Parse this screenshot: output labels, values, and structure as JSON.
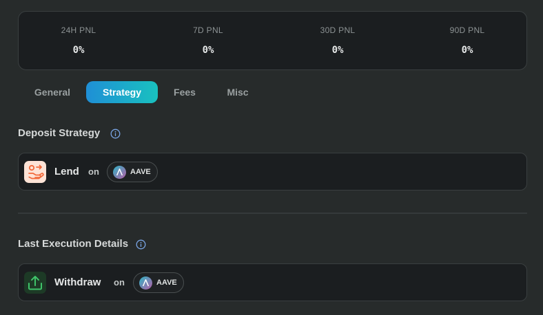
{
  "pnl": [
    {
      "label": "24H PNL",
      "value": "0%"
    },
    {
      "label": "7D PNL",
      "value": "0%"
    },
    {
      "label": "30D PNL",
      "value": "0%"
    },
    {
      "label": "90D PNL",
      "value": "0%"
    }
  ],
  "tabs": [
    {
      "label": "General",
      "active": false
    },
    {
      "label": "Strategy",
      "active": true
    },
    {
      "label": "Fees",
      "active": false
    },
    {
      "label": "Misc",
      "active": false
    }
  ],
  "deposit_strategy": {
    "title": "Deposit Strategy",
    "info_icon": "info-icon",
    "action_icon": "lend-icon",
    "action": "Lend",
    "connector": "on",
    "protocol_logo": "aave-logo",
    "protocol": "AAVE"
  },
  "last_execution": {
    "title": "Last Execution Details",
    "info_icon": "info-icon",
    "action_icon": "withdraw-icon",
    "action": "Withdraw",
    "connector": "on",
    "protocol_logo": "aave-logo",
    "protocol": "AAVE"
  },
  "colors": {
    "background": "#272b2b",
    "card": "#1b1e20",
    "tab_active_start": "#1f8fd6",
    "tab_active_end": "#19c1bf",
    "info": "#7aa6e6",
    "lend_icon_bg": "#fde3d6",
    "lend_icon_fg": "#f2693a",
    "withdraw_icon_bg": "#1d3a26",
    "withdraw_icon_fg": "#3fc46a"
  }
}
